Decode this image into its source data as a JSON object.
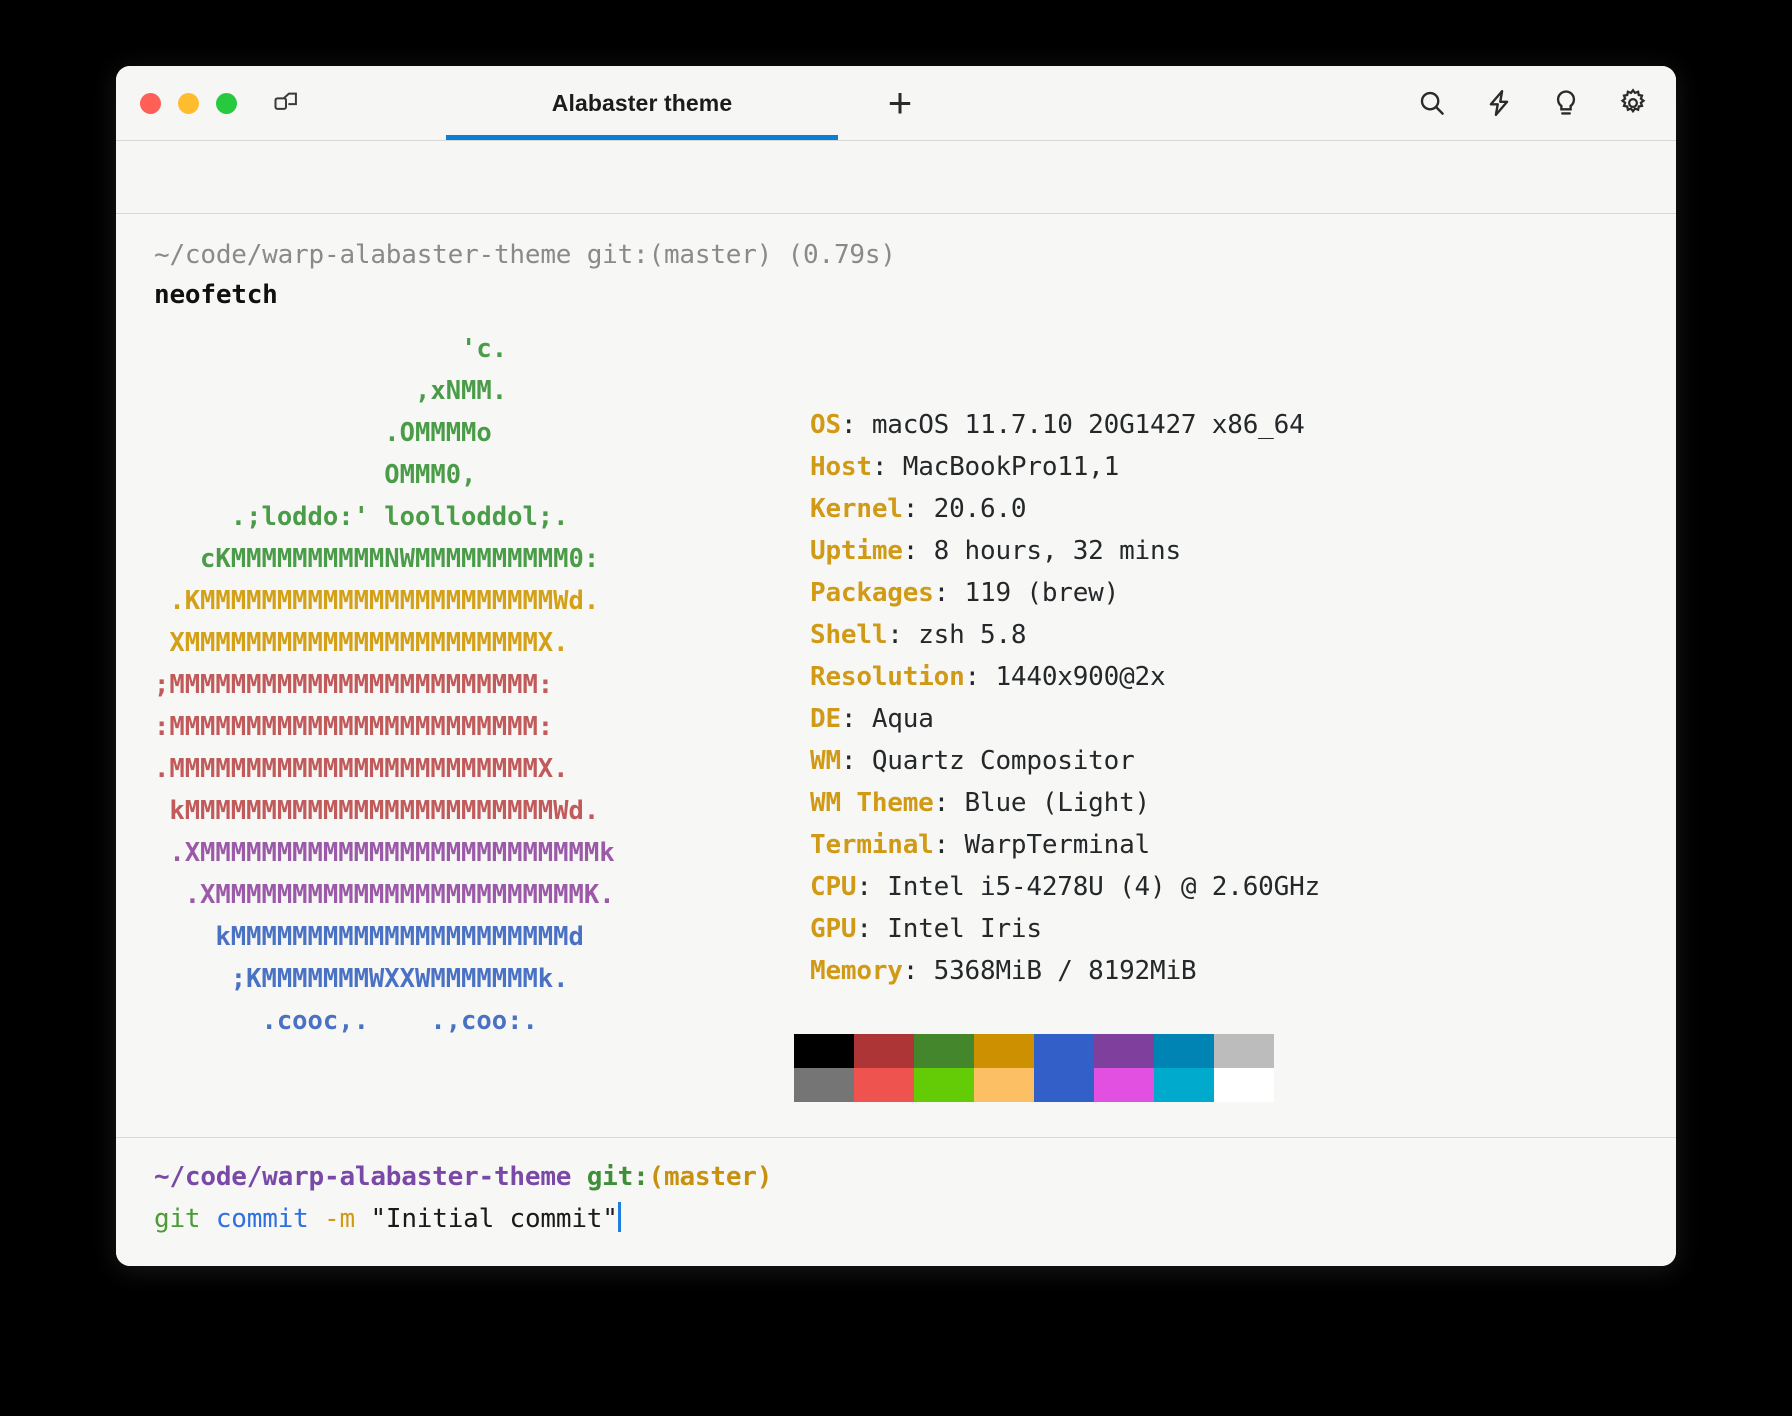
{
  "window": {
    "traffic_lights": [
      "close",
      "minimize",
      "zoom"
    ],
    "layout_icon": "split-pane-icon",
    "new_tab_label": "+",
    "accent_color": "#0b7fd4"
  },
  "tabs": [
    {
      "label": "Alabaster theme",
      "active": true
    }
  ],
  "titlebar_actions": [
    {
      "name": "search-icon",
      "label": "Search"
    },
    {
      "name": "lightning-icon",
      "label": "Workflows"
    },
    {
      "name": "lightbulb-icon",
      "label": "Tips"
    },
    {
      "name": "gear-icon",
      "label": "Settings"
    }
  ],
  "blocks": {
    "completed": {
      "prompt": "~/code/warp-alabaster-theme git:(master) (0.79s)",
      "command": "neofetch"
    },
    "input": {
      "prompt_path": "~/code/warp-alabaster-theme",
      "prompt_git": "git:",
      "prompt_branch": "(master)",
      "cmd_program": "git",
      "cmd_sub": "commit",
      "cmd_flag": "-m",
      "cmd_string": "\"Initial commit\"",
      "caret": true
    }
  },
  "neofetch": {
    "ascii_lines": [
      {
        "text": "                    'c.",
        "color": "#4a9c48"
      },
      {
        "text": "                 ,xNMM.",
        "color": "#4a9c48"
      },
      {
        "text": "               .OMMMMo",
        "color": "#4a9c48"
      },
      {
        "text": "               OMMM0,",
        "color": "#4a9c48"
      },
      {
        "text": "     .;loddo:' loolloddol;.",
        "color": "#4a9c48"
      },
      {
        "text": "   cKMMMMMMMMMMNWMMMMMMMMMM0:",
        "color": "#4a9c48"
      },
      {
        "text": " .KMMMMMMMMMMMMMMMMMMMMMMMWd.",
        "color": "#d4a017"
      },
      {
        "text": " XMMMMMMMMMMMMMMMMMMMMMMMX.",
        "color": "#d4a017"
      },
      {
        "text": ";MMMMMMMMMMMMMMMMMMMMMMMM:",
        "color": "#c15a5a"
      },
      {
        "text": ":MMMMMMMMMMMMMMMMMMMMMMMM:",
        "color": "#c15a5a"
      },
      {
        "text": ".MMMMMMMMMMMMMMMMMMMMMMMMX.",
        "color": "#c15a5a"
      },
      {
        "text": " kMMMMMMMMMMMMMMMMMMMMMMMMWd.",
        "color": "#c15a5a"
      },
      {
        "text": " .XMMMMMMMMMMMMMMMMMMMMMMMMMMk",
        "color": "#9b5aa8"
      },
      {
        "text": "  .XMMMMMMMMMMMMMMMMMMMMMMMMK.",
        "color": "#9b5aa8"
      },
      {
        "text": "    kMMMMMMMMMMMMMMMMMMMMMMd",
        "color": "#4a72c4"
      },
      {
        "text": "     ;KMMMMMMMWXXWMMMMMMMk.",
        "color": "#4a72c4"
      },
      {
        "text": "       .cooc,.    .,coo:.",
        "color": "#4a72c4"
      }
    ],
    "info": [
      {
        "key": "OS",
        "value": "macOS 11.7.10 20G1427 x86_64"
      },
      {
        "key": "Host",
        "value": "MacBookPro11,1"
      },
      {
        "key": "Kernel",
        "value": "20.6.0"
      },
      {
        "key": "Uptime",
        "value": "8 hours, 32 mins"
      },
      {
        "key": "Packages",
        "value": "119 (brew)"
      },
      {
        "key": "Shell",
        "value": "zsh 5.8"
      },
      {
        "key": "Resolution",
        "value": "1440x900@2x"
      },
      {
        "key": "DE",
        "value": "Aqua"
      },
      {
        "key": "WM",
        "value": "Quartz Compositor"
      },
      {
        "key": "WM Theme",
        "value": "Blue (Light)"
      },
      {
        "key": "Terminal",
        "value": "WarpTerminal"
      },
      {
        "key": "CPU",
        "value": "Intel i5-4278U (4) @ 2.60GHz"
      },
      {
        "key": "GPU",
        "value": "Intel Iris"
      },
      {
        "key": "Memory",
        "value": "5368MiB / 8192MiB"
      }
    ],
    "palette_row1": [
      "#000000",
      "#ad3535",
      "#44862c",
      "#cc9000",
      "#3360c8",
      "#7e3f9d",
      "#0084b4",
      "#bcbcbc"
    ],
    "palette_row2": [
      "#757575",
      "#ef5350",
      "#63cc07",
      "#fcbf63",
      "#3360c8",
      "#e250e2",
      "#00aacc",
      "#ffffff"
    ]
  },
  "colors": {
    "info_key": "#d19a16",
    "info_value": "#25282a",
    "prompt_dim": "#8a8a88",
    "prompt_path": "#7a48a8",
    "prompt_git": "#3f8f3a",
    "prompt_branch": "#c8900f",
    "cmd_program": "#4a9c35",
    "cmd_sub": "#2f6fe0",
    "cmd_flag": "#d19a16",
    "cmd_string": "#1a1a1a",
    "caret": "#1f7fe0"
  }
}
